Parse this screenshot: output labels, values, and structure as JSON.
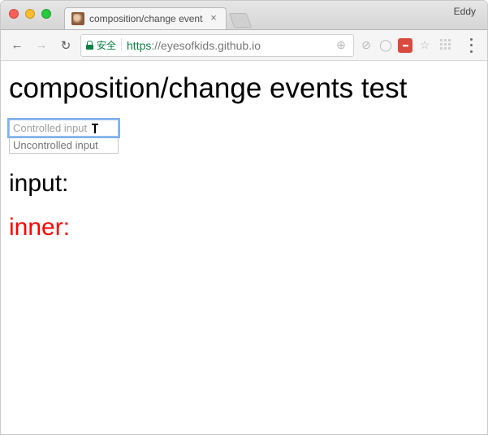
{
  "window": {
    "profile_name": "Eddy",
    "tab": {
      "title": "composition/change events te",
      "close_glyph": "×"
    }
  },
  "toolbar": {
    "back_glyph": "←",
    "forward_glyph": "→",
    "reload_glyph": "↻",
    "secure_label": "安全",
    "url_scheme": "https",
    "url_host": "://eyesofkids.github.io",
    "zoom_glyph": "⊕",
    "noscript_glyph": "⊘",
    "profile_glyph": "◯",
    "ext_badge_text": "•••",
    "star_glyph": "☆"
  },
  "page": {
    "title": "composition/change events test",
    "controlled_placeholder": "Controlled input",
    "uncontrolled_placeholder": "Uncontrolled input",
    "input_label": "input:",
    "input_value": "",
    "inner_label": "inner:",
    "inner_value": ""
  }
}
